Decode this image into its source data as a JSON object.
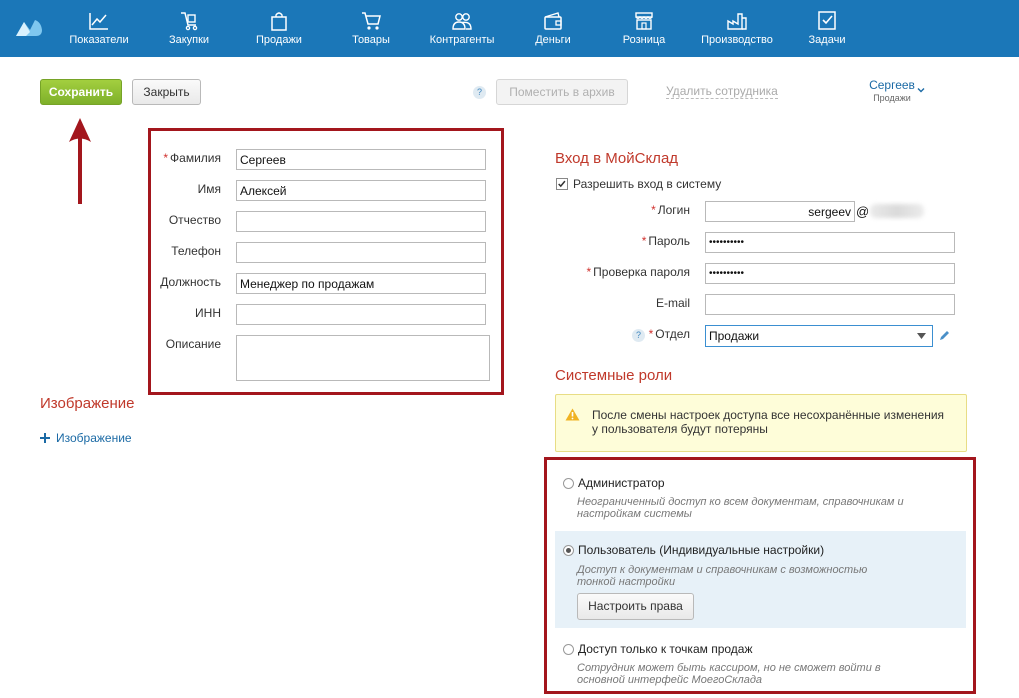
{
  "nav": [
    {
      "label": "Показатели",
      "icon": "chart-icon"
    },
    {
      "label": "Закупки",
      "icon": "cart-trolley-icon"
    },
    {
      "label": "Продажи",
      "icon": "shopping-bag-icon"
    },
    {
      "label": "Товары",
      "icon": "cart-icon"
    },
    {
      "label": "Контрагенты",
      "icon": "people-icon"
    },
    {
      "label": "Деньги",
      "icon": "wallet-icon"
    },
    {
      "label": "Розница",
      "icon": "store-icon"
    },
    {
      "label": "Производство",
      "icon": "factory-icon"
    },
    {
      "label": "Задачи",
      "icon": "checkbox-icon"
    }
  ],
  "toolbar": {
    "save_label": "Сохранить",
    "close_label": "Закрыть",
    "help_glyph": "?",
    "archive_label": "Поместить в архив",
    "delete_label": "Удалить сотрудника",
    "user_name": "Сергеев",
    "user_dept": "Продажи"
  },
  "form": {
    "lastname_label": "Фамилия",
    "lastname_value": "Сергеев",
    "firstname_label": "Имя",
    "firstname_value": "Алексей",
    "patronymic_label": "Отчество",
    "patronymic_value": "",
    "phone_label": "Телефон",
    "phone_value": "",
    "position_label": "Должность",
    "position_value": "Менеджер по продажам",
    "inn_label": "ИНН",
    "inn_value": "",
    "description_label": "Описание",
    "description_value": "",
    "required_mark": "*"
  },
  "image": {
    "title": "Изображение",
    "add_label": "Изображение"
  },
  "login": {
    "title": "Вход в МойСклад",
    "allow_label": "Разрешить вход в систему",
    "allow_checked": true,
    "login_label": "Логин",
    "login_value": "sergeev",
    "at_sign": "@",
    "password_label": "Пароль",
    "password_value": "••••••••••",
    "confirm_label": "Проверка пароля",
    "confirm_value": "••••••••••",
    "email_label": "E-mail",
    "email_value": "",
    "dept_label": "Отдел",
    "dept_value": "Продажи"
  },
  "roles": {
    "title": "Системные роли",
    "warning": "После смены настроек доступа все несохранённые изменения у пользователя будут потеряны",
    "items": [
      {
        "title": "Администратор",
        "desc": "Неограниченный доступ ко всем документам, справочникам и настройкам системы",
        "selected": false
      },
      {
        "title": "Пользователь (Индивидуальные настройки)",
        "desc": "Доступ к документам и справочникам с возможностью тонкой настройки",
        "selected": true
      },
      {
        "title": "Доступ только к точкам продаж",
        "desc": "Сотрудник может быть кассиром, но не сможет войти в основной интерфейс МоегоСклада",
        "selected": false
      }
    ],
    "configure_label": "Настроить права"
  },
  "colors": {
    "nav_bg": "#1b77b8",
    "save_green": "#8fc232",
    "accent_red": "#c0392b",
    "annotation_red": "#a3161d"
  }
}
